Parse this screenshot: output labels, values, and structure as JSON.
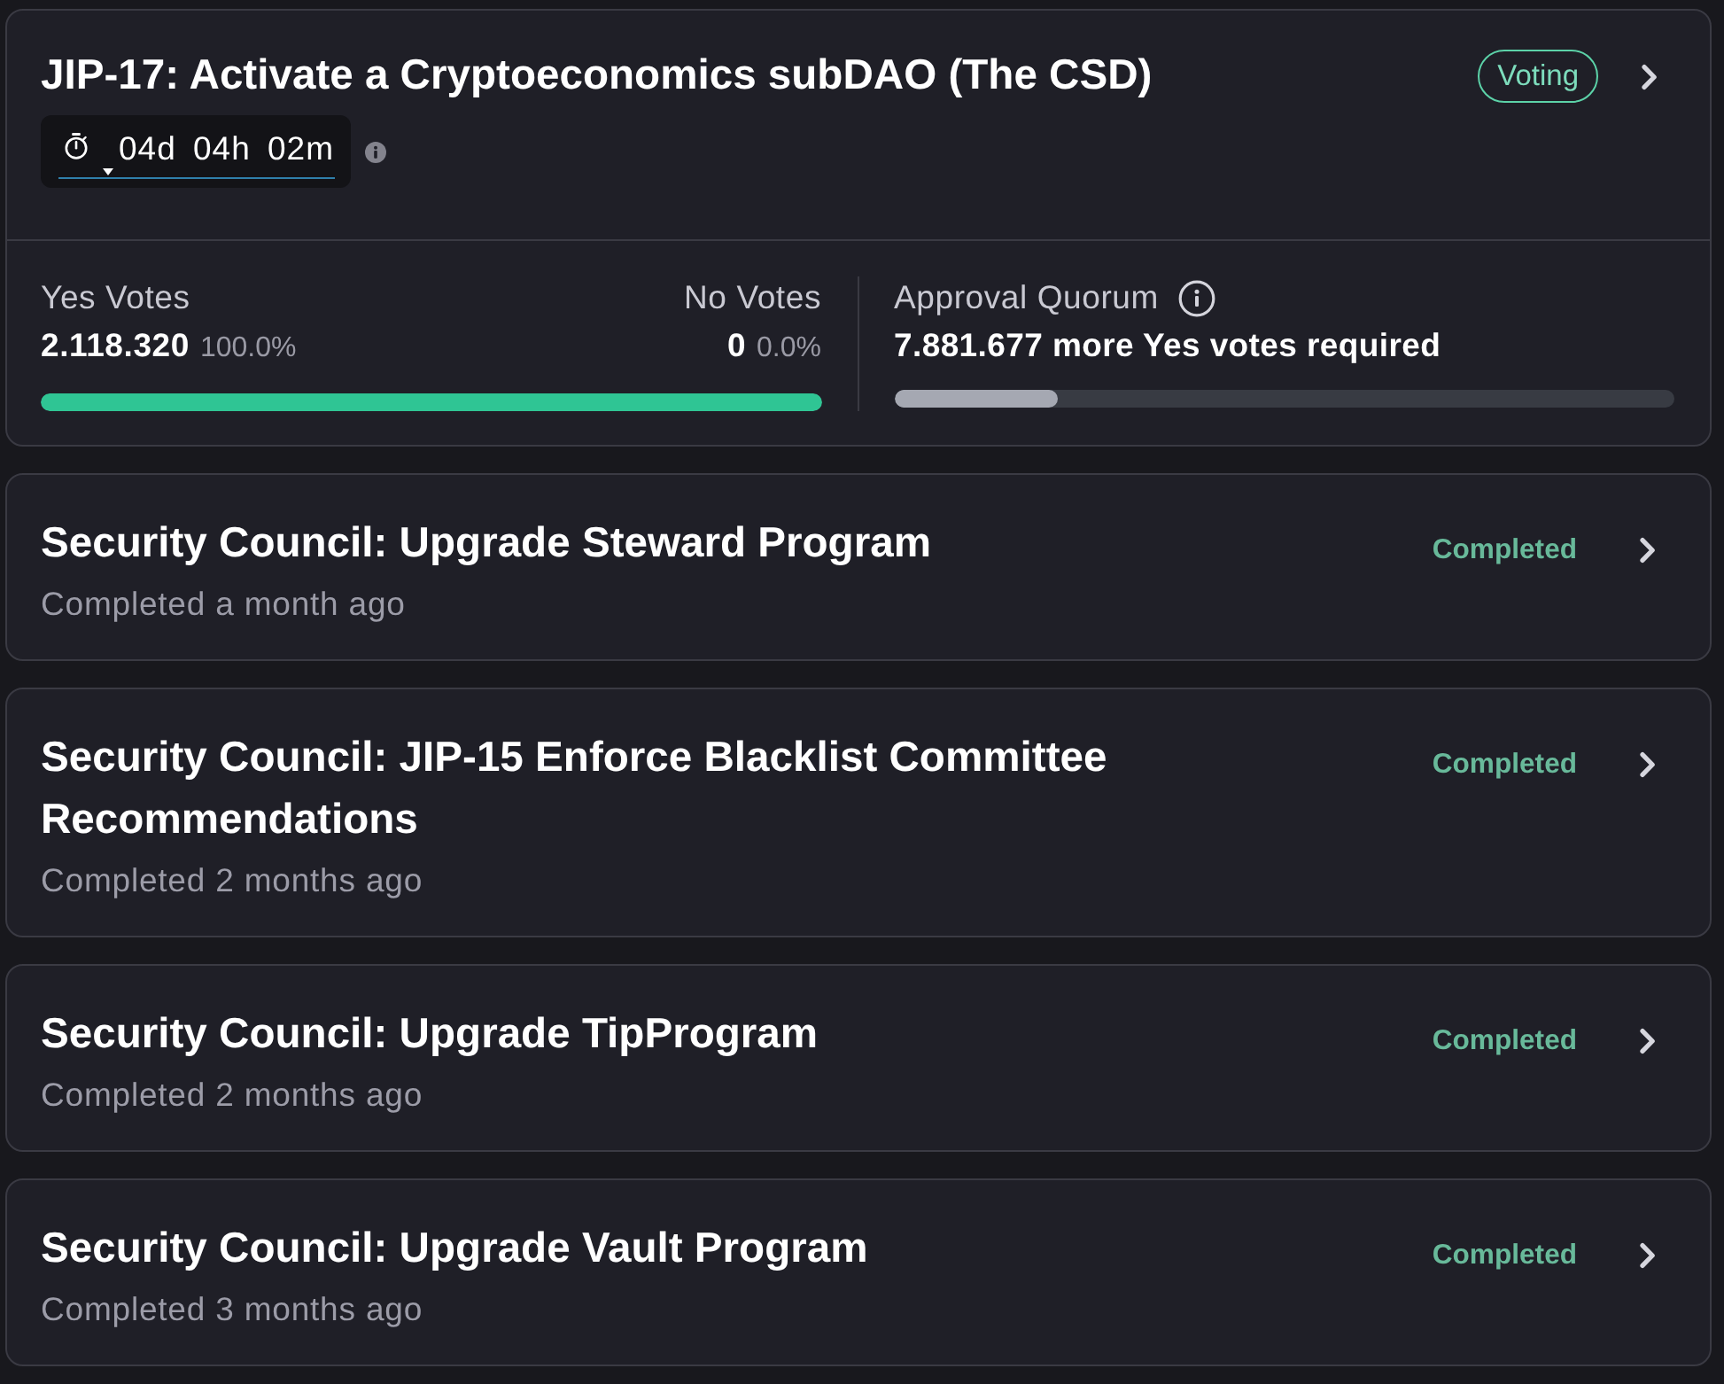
{
  "proposals": [
    {
      "kind": "voting",
      "title": "JIP-17: Activate a Cryptoeconomics subDAO (The CSD)",
      "status": "Voting",
      "countdown": "04d 04h 02m",
      "yes_votes": {
        "label": "Yes Votes",
        "count": "2.118.320",
        "percent": "100.0%"
      },
      "no_votes": {
        "label": "No Votes",
        "count": "0",
        "percent": "0.0%"
      },
      "vote_bar": {
        "level": 1.0
      },
      "quorum": {
        "label": "Approval Quorum",
        "note": "7.881.677 more Yes votes required",
        "level": 0.21
      }
    },
    {
      "kind": "completed",
      "title": "Security Council: Upgrade Steward Program",
      "status": "Completed",
      "subtitle": "Completed a month ago"
    },
    {
      "kind": "completed",
      "title": "Security Council: JIP-15 Enforce Blacklist Committee Recommendations",
      "status": "Completed",
      "subtitle": "Completed 2 months ago"
    },
    {
      "kind": "completed",
      "title": "Security Council: Upgrade TipProgram",
      "status": "Completed",
      "subtitle": "Completed 2 months ago"
    },
    {
      "kind": "completed",
      "title": "Security Council: Upgrade Vault Program",
      "status": "Completed",
      "subtitle": "Completed 3 months ago"
    }
  ]
}
